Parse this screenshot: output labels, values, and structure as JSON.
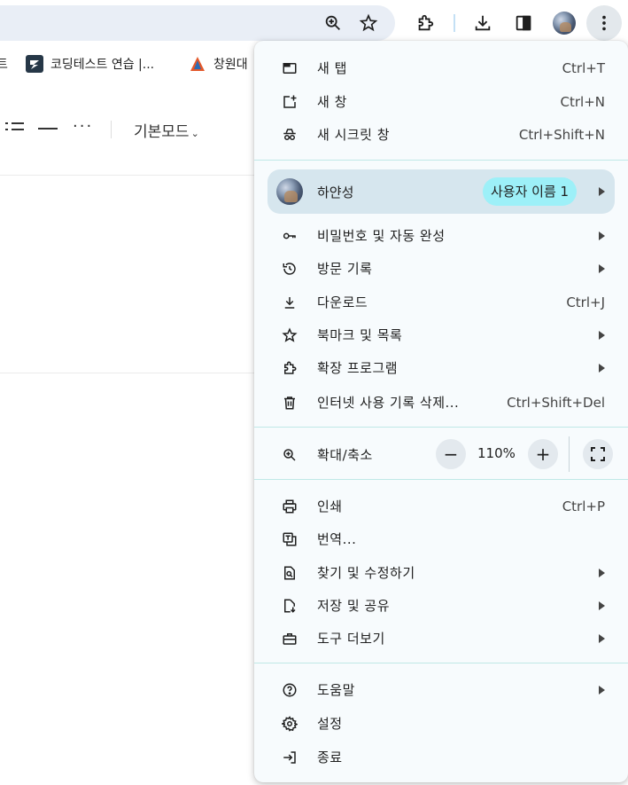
{
  "bookmarks": [
    {
      "label": "트"
    },
    {
      "label": "코딩테스트 연습 |..."
    },
    {
      "label": "창원대"
    }
  ],
  "editor": {
    "mode_label": "기본모드"
  },
  "menu": {
    "group1": [
      {
        "label": "새 탭",
        "shortcut": "Ctrl+T"
      },
      {
        "label": "새 창",
        "shortcut": "Ctrl+N"
      },
      {
        "label": "새 시크릿 창",
        "shortcut": "Ctrl+Shift+N"
      }
    ],
    "profile": {
      "name": "하얀성",
      "chip": "사용자 이름 1"
    },
    "group2": [
      {
        "label": "비밀번호 및 자동 완성",
        "shortcut": ""
      },
      {
        "label": "방문 기록",
        "shortcut": ""
      },
      {
        "label": "다운로드",
        "shortcut": "Ctrl+J"
      },
      {
        "label": "북마크 및 목록",
        "shortcut": ""
      },
      {
        "label": "확장 프로그램",
        "shortcut": ""
      },
      {
        "label": "인터넷 사용 기록 삭제...",
        "shortcut": "Ctrl+Shift+Del"
      }
    ],
    "zoom": {
      "label": "확대/축소",
      "value": "110%",
      "minus": "−",
      "plus": "+"
    },
    "group3": [
      {
        "label": "인쇄",
        "shortcut": "Ctrl+P"
      },
      {
        "label": "번역...",
        "shortcut": ""
      },
      {
        "label": "찾기 및 수정하기",
        "shortcut": ""
      },
      {
        "label": "저장 및 공유",
        "shortcut": ""
      },
      {
        "label": "도구 더보기",
        "shortcut": ""
      }
    ],
    "group4": [
      {
        "label": "도움말",
        "shortcut": ""
      },
      {
        "label": "설정",
        "shortcut": ""
      },
      {
        "label": "종료",
        "shortcut": ""
      }
    ]
  }
}
